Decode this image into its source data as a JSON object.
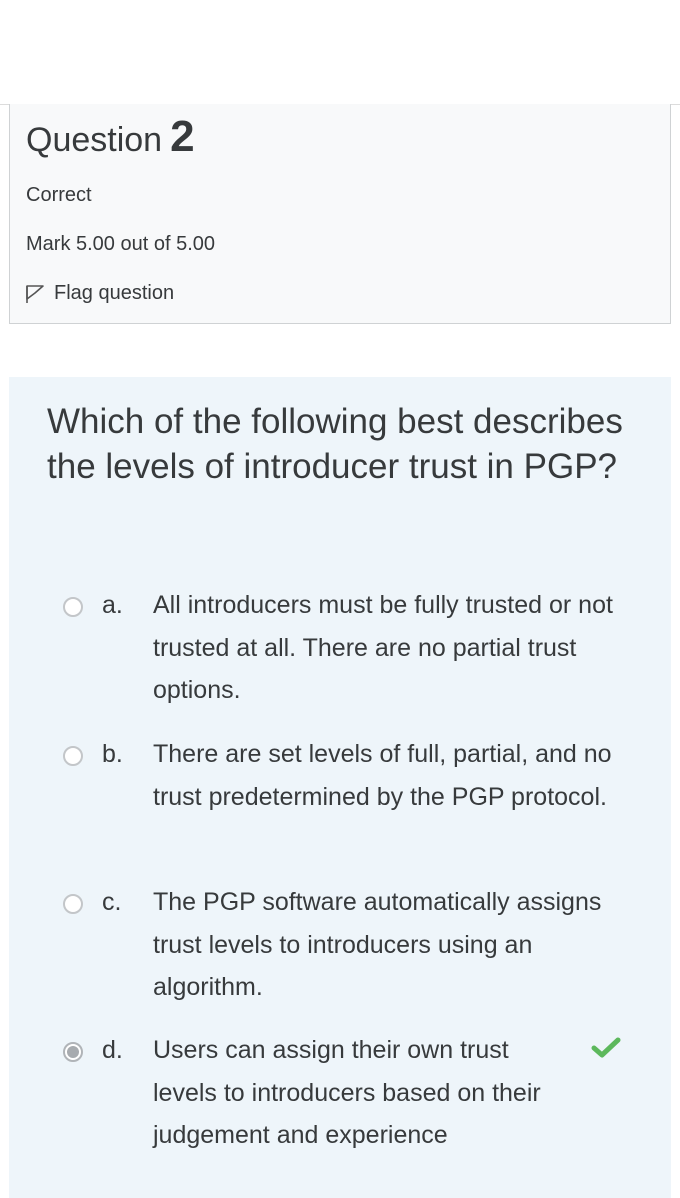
{
  "question": {
    "label": "Question",
    "number": "2",
    "state": "Correct",
    "grade": "Mark 5.00 out of 5.00",
    "flag_label": "Flag question"
  },
  "content": {
    "question_text": "Which of the following best describes the levels of introducer trust in PGP?",
    "answers": [
      {
        "letter": "a.",
        "text": "All introducers must be fully trusted or not trusted at all. There are no partial trust options.",
        "selected": false
      },
      {
        "letter": "b.",
        "text": "There are set levels of full, partial, and no trust predetermined by the PGP protocol.",
        "selected": false
      },
      {
        "letter": "c.",
        "text": "The PGP software automatically assigns trust levels to introducers using an algorithm.",
        "selected": false
      },
      {
        "letter": "d.",
        "text": "Users can assign their own trust levels to introducers based on their judgement and experience",
        "selected": true
      }
    ]
  },
  "colors": {
    "content_bg": "#eef5fa",
    "info_bg": "#f8f9fa",
    "correct_check": "#5cb85c",
    "text": "#373a3c"
  },
  "icons": {
    "flag": "flag-icon",
    "correct": "check-icon"
  }
}
